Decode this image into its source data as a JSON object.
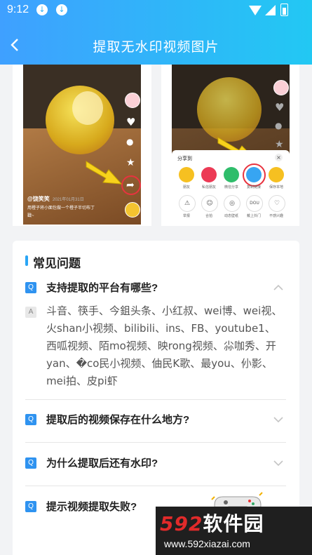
{
  "status_bar": {
    "time": "9:12"
  },
  "header": {
    "title": "提取无水印视频图片"
  },
  "left_shot": {
    "caption_user": "@饶笑笑",
    "caption_date": "2021年01月31日",
    "caption_text": "用橙子将小面包做一个橙子半切布丁",
    "caption_more": "戳~"
  },
  "right_shot": {
    "sheet_title": "分享到",
    "close": "×",
    "row1": [
      "朋友",
      "私信朋友",
      "微信分享",
      "复制链接",
      "保存本地"
    ],
    "row2": [
      "举报",
      "合拍",
      "动态壁纸",
      "戴上抖门",
      "不感兴趣"
    ],
    "row2_icons": [
      "⚠",
      "☺",
      "◎",
      "DOU",
      "♡"
    ]
  },
  "faq": {
    "heading": "常见问题",
    "q_badge": "Q",
    "a_badge": "A",
    "items": [
      {
        "question": "支持提取的平台有哪些?",
        "answer": "斗音、筷手、今鉏头条、小红叔、wei博、wei视、火shan小视频、bilibili、ins、FB、youtube1、西呱视频、陌mo视频、映rong视频、尛咖秀、开yan、�co民小视频、伷民K歌、最you、仦影、mei拍、皮pi虾"
      },
      {
        "question": "提取后的视频保存在什么地方?"
      },
      {
        "question": "为什么提取后还有水印?"
      },
      {
        "question": "提示视频提取失败?"
      }
    ]
  },
  "watermark": {
    "brand_num": "592",
    "brand_text": "软件园",
    "url": "www.592xiazai.com"
  },
  "colors": {
    "header_start": "#3fa0ff",
    "header_end": "#22c8f3",
    "accent": "#2f93f0",
    "highlight": "#e8333f"
  }
}
